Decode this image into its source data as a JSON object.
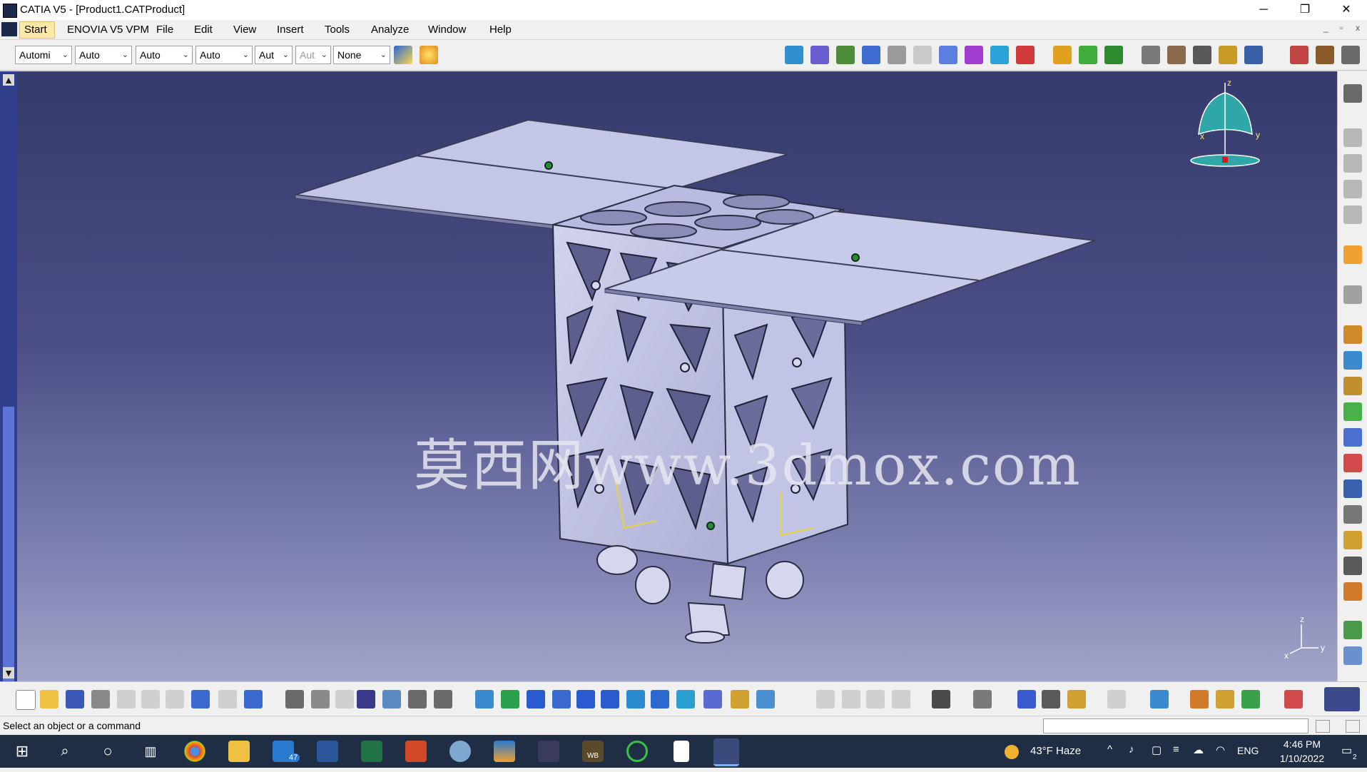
{
  "window": {
    "title": "CATIA V5 - [Product1.CATProduct]",
    "controls": [
      "─",
      "❐",
      "✕"
    ]
  },
  "menubar": {
    "items": [
      "Start",
      "ENOVIA V5 VPM",
      "File",
      "Edit",
      "View",
      "Insert",
      "Tools",
      "Analyze",
      "Window",
      "Help"
    ],
    "mdi_controls": [
      "_",
      "▫",
      "x"
    ]
  },
  "toolbar_top": {
    "combos": [
      {
        "value": "Automi",
        "disabled": false
      },
      {
        "value": "Auto",
        "disabled": false
      },
      {
        "value": "Auto",
        "disabled": false
      },
      {
        "value": "Auto",
        "disabled": false
      },
      {
        "value": "Aut",
        "disabled": false
      },
      {
        "value": "Aut",
        "disabled": true
      },
      {
        "value": "None",
        "disabled": false
      }
    ]
  },
  "viewport": {
    "watermark": "莫西网www.3dmox.com",
    "compass_axes": {
      "x": "x",
      "y": "y",
      "z": "z"
    },
    "triad_axes": {
      "x": "x",
      "y": "y",
      "z": "z"
    }
  },
  "statusbar": {
    "text": "Select an object or a command",
    "command_input": ""
  },
  "taskbar": {
    "mail_badge": "47",
    "wb_label": "WB",
    "weather": "43°F  Haze",
    "language": "ENG",
    "time": "4:46 PM",
    "date": "1/10/2022",
    "notifications": "2"
  },
  "colors": {
    "viewport_top": "#353a6c",
    "viewport_bottom": "#a3a5c8",
    "part_fill": "#c9cbe6",
    "taskbar": "#1f2d45",
    "start_highlight": "#ffe7a6"
  }
}
